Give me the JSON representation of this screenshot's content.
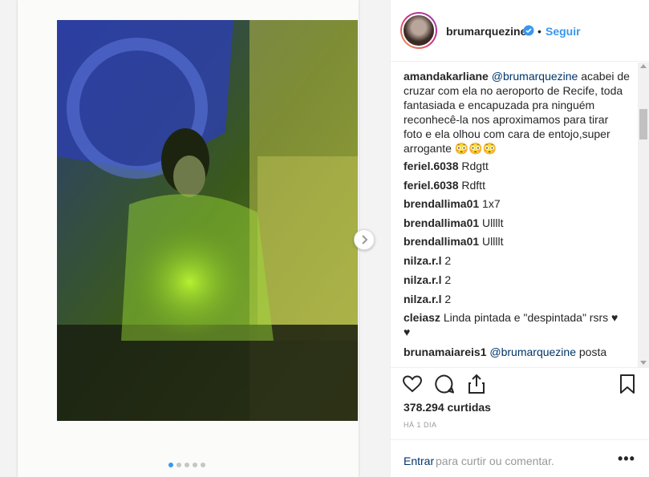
{
  "post": {
    "username": "brumarquezine",
    "separator": "•",
    "follow_label": "Seguir"
  },
  "comments": [
    {
      "user": "amandakarliane",
      "mention": "@brumarquezine",
      "lines": [
        "acabei de",
        "cruzar com ela no aeroporto de Recife, toda",
        "fantasiada e encapuzada pra ninguém",
        "reconhecê-la nos aproximamos para tirar",
        "foto e ela olhou com cara de entojo,super",
        "arrogante 😳😳😳"
      ]
    },
    {
      "user": "feriel.6038",
      "text": "Rdgtt"
    },
    {
      "user": "feriel.6038",
      "text": "Rdftt"
    },
    {
      "user": "brendallima01",
      "text": "1x7"
    },
    {
      "user": "brendallima01",
      "text": "Ullllt"
    },
    {
      "user": "brendallima01",
      "text": "Ullllt"
    },
    {
      "user": "nilza.r.l",
      "text": "2"
    },
    {
      "user": "nilza.r.l",
      "text": "2"
    },
    {
      "user": "nilza.r.l",
      "text": "2"
    },
    {
      "user": "cleiasz",
      "lines": [
        "Linda pintada e \"despintada\" rsrs ♥",
        "♥"
      ]
    },
    {
      "user": "brunamaiareis1",
      "mention": "@brumarquezine",
      "text": "posta"
    }
  ],
  "footer": {
    "likes": "378.294 curtidas",
    "time": "HÁ 1 DIA",
    "login_link": "Entrar",
    "login_rest": "para curtir ou comentar.",
    "more": "•••"
  },
  "icons": {
    "like": "heart-icon",
    "comment": "comment-icon",
    "share": "share-icon",
    "save": "bookmark-icon",
    "verified": "verified-badge-icon",
    "next": "chevron-right-icon"
  },
  "carousel": {
    "count": 5,
    "active_index": 0
  },
  "colors": {
    "link": "#3897f0",
    "mention": "#003569",
    "muted": "#999999"
  }
}
